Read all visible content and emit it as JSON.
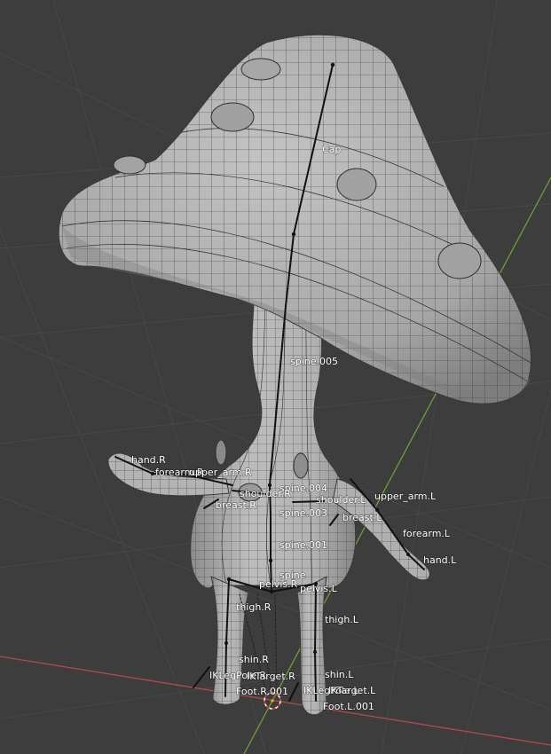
{
  "viewport": {
    "background": "#3d3d3d",
    "grid_color": "#4a4a4a",
    "x_axis_color": "#b7474f",
    "y_axis_color": "#6fa030"
  },
  "model": {
    "surface_color": "#b5b5b5",
    "wire_color": "#2a2a2a",
    "bone_color": "#111111"
  },
  "bones": {
    "cap": "Cap",
    "spine_005": "spine.005",
    "spine_004": "spine.004",
    "spine_003": "spine.003",
    "spine_001": "spine.001",
    "spine": "spine",
    "hand_r": "hand.R",
    "forearm_r": "forearm.R",
    "upper_arm_r": "upper_arm.R",
    "shoulder_r": "shoulder.R",
    "breast_r": "breast.R",
    "shoulder_l": "shoulder.L",
    "upper_arm_l": "upper_arm.L",
    "breast_l": "breast.L",
    "forearm_l": "forearm.L",
    "hand_l": "hand.L",
    "pelvis_r": "pelvis.R",
    "pelvis_l": "pelvis.L",
    "thigh_r": "thigh.R",
    "thigh_l": "thigh.L",
    "shin_r": "shin.R",
    "shin_l": "shin.L",
    "ik_leg_pole_r": "IKLegPole.R",
    "ik_target_r": "IKTarget.R",
    "foot_r_001": "Foot.R.001",
    "ik_leg_pole_l": "IKLegPole.L",
    "ik_target_l": "IKTarget.L",
    "foot_l_001": "Foot.L.001"
  }
}
